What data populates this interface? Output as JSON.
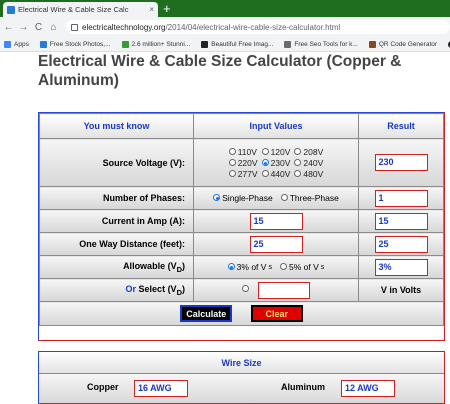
{
  "browser": {
    "tab_title": "Electrical Wire & Cable Size Calc",
    "tab_close": "×",
    "new_tab": "+",
    "nav_back": "←",
    "nav_forward": "→",
    "nav_reload": "C",
    "nav_home": "⌂",
    "url_host": "electricaltechnology.org",
    "url_path": "/2014/04/electrical-wire-cable-size-calculator.html"
  },
  "bookmarks": [
    {
      "label": "Apps",
      "color": "#4285f4"
    },
    {
      "label": "Free Stock Photos,...",
      "color": "#2a7bd5"
    },
    {
      "label": "2.6 million+ Stunni...",
      "color": "#3a9a3a"
    },
    {
      "label": "Beautiful Free Imag...",
      "color": "#222222"
    },
    {
      "label": "Free Seo Tools for k...",
      "color": "#6b6b6b"
    },
    {
      "label": "QR Code Generator",
      "color": "#8a4a2a"
    },
    {
      "label": "Cl",
      "color": "#222222"
    }
  ],
  "page": {
    "title": "Electrical Wire & Cable Size Calculator (Copper & Aluminum)"
  },
  "calculator": {
    "headers": {
      "col1": "You must know",
      "col2": "Input Values",
      "col3": "Result"
    },
    "source_voltage": {
      "label": "Source Voltage (V):",
      "options": [
        "110V",
        "120V",
        "208V",
        "220V",
        "230V",
        "240V",
        "277V",
        "440V",
        "480V"
      ],
      "selected": "230V",
      "result": "230"
    },
    "phases": {
      "label": "Number of Phases:",
      "options": [
        "Single-Phase",
        "Three-Phase"
      ],
      "selected": "Single-Phase",
      "result": "1"
    },
    "current": {
      "label": "Current in Amp (A):",
      "value": "15",
      "result": "15"
    },
    "distance": {
      "label": "One Way Distance (feet):",
      "value": "25",
      "result": "25"
    },
    "allowable": {
      "label_main": "Allowable (V",
      "label_sub": "D",
      "label_end": ")",
      "opt1_main": "3% of V",
      "opt1_sub": "s",
      "opt2_main": "5% of V",
      "opt2_sub": "s",
      "selected": "3% of Vs",
      "result": "3%"
    },
    "select": {
      "or_word": "Or",
      "label_main": " Select (V",
      "label_sub": "D",
      "label_end": ")",
      "value": "",
      "result_label": "V in Volts"
    },
    "buttons": {
      "calculate": "Calculate",
      "clear": "Clear"
    },
    "colors": {
      "accent_blue": "#1a38c8",
      "accent_red": "#d02020"
    }
  },
  "wire_size": {
    "header": "Wire Size",
    "copper_label": "Copper",
    "copper_value": "16 AWG",
    "aluminum_label": "Aluminum",
    "aluminum_value": "12 AWG"
  }
}
